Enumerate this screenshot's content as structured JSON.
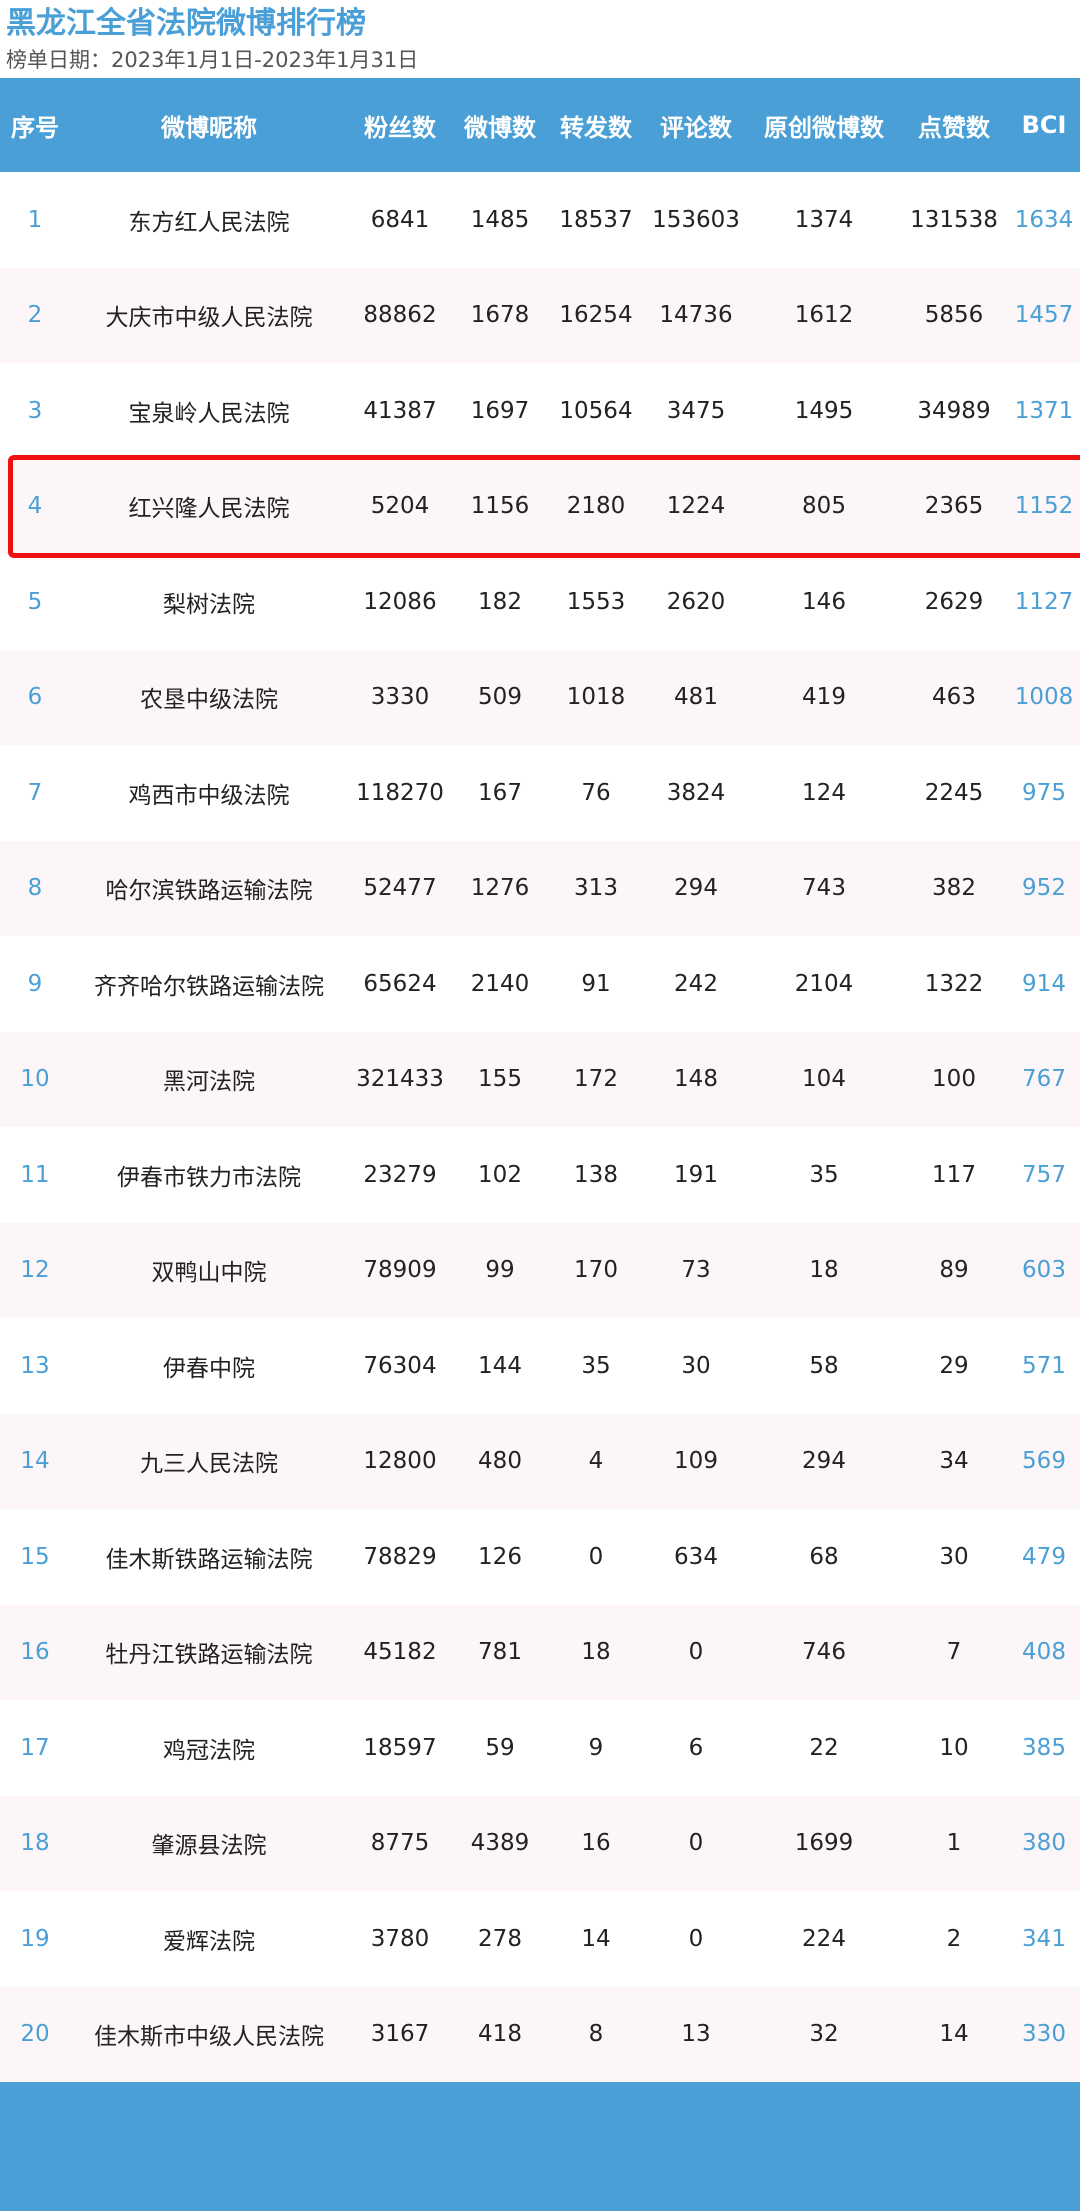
{
  "page": {
    "title": "黑龙江全省法院微博排行榜",
    "subtitle": "榜单日期：2023年1月1日-2023年1月31日"
  },
  "colors": {
    "accent": "#4a9fd6",
    "highlight": "#ee1111",
    "row_alt": "#fdf6f8"
  },
  "table": {
    "headers": [
      "序号",
      "微博昵称",
      "粉丝数",
      "微博数",
      "转发数",
      "评论数",
      "原创微博数",
      "点赞数",
      "BCI"
    ],
    "highlighted_rank": "4",
    "rows": [
      {
        "rank": "1",
        "name": "东方红人民法院",
        "fans": "6841",
        "posts": "1485",
        "reposts": "18537",
        "comments": "153603",
        "original": "1374",
        "likes": "131538",
        "bci": "1634"
      },
      {
        "rank": "2",
        "name": "大庆市中级人民法院",
        "fans": "88862",
        "posts": "1678",
        "reposts": "16254",
        "comments": "14736",
        "original": "1612",
        "likes": "5856",
        "bci": "1457"
      },
      {
        "rank": "3",
        "name": "宝泉岭人民法院",
        "fans": "41387",
        "posts": "1697",
        "reposts": "10564",
        "comments": "3475",
        "original": "1495",
        "likes": "34989",
        "bci": "1371"
      },
      {
        "rank": "4",
        "name": "红兴隆人民法院",
        "fans": "5204",
        "posts": "1156",
        "reposts": "2180",
        "comments": "1224",
        "original": "805",
        "likes": "2365",
        "bci": "1152"
      },
      {
        "rank": "5",
        "name": "梨树法院",
        "fans": "12086",
        "posts": "182",
        "reposts": "1553",
        "comments": "2620",
        "original": "146",
        "likes": "2629",
        "bci": "1127"
      },
      {
        "rank": "6",
        "name": "农垦中级法院",
        "fans": "3330",
        "posts": "509",
        "reposts": "1018",
        "comments": "481",
        "original": "419",
        "likes": "463",
        "bci": "1008"
      },
      {
        "rank": "7",
        "name": "鸡西市中级法院",
        "fans": "118270",
        "posts": "167",
        "reposts": "76",
        "comments": "3824",
        "original": "124",
        "likes": "2245",
        "bci": "975"
      },
      {
        "rank": "8",
        "name": "哈尔滨铁路运输法院",
        "fans": "52477",
        "posts": "1276",
        "reposts": "313",
        "comments": "294",
        "original": "743",
        "likes": "382",
        "bci": "952"
      },
      {
        "rank": "9",
        "name": "齐齐哈尔铁路运输法院",
        "fans": "65624",
        "posts": "2140",
        "reposts": "91",
        "comments": "242",
        "original": "2104",
        "likes": "1322",
        "bci": "914"
      },
      {
        "rank": "10",
        "name": "黑河法院",
        "fans": "321433",
        "posts": "155",
        "reposts": "172",
        "comments": "148",
        "original": "104",
        "likes": "100",
        "bci": "767"
      },
      {
        "rank": "11",
        "name": "伊春市铁力市法院",
        "fans": "23279",
        "posts": "102",
        "reposts": "138",
        "comments": "191",
        "original": "35",
        "likes": "117",
        "bci": "757"
      },
      {
        "rank": "12",
        "name": "双鸭山中院",
        "fans": "78909",
        "posts": "99",
        "reposts": "170",
        "comments": "73",
        "original": "18",
        "likes": "89",
        "bci": "603"
      },
      {
        "rank": "13",
        "name": "伊春中院",
        "fans": "76304",
        "posts": "144",
        "reposts": "35",
        "comments": "30",
        "original": "58",
        "likes": "29",
        "bci": "571"
      },
      {
        "rank": "14",
        "name": "九三人民法院",
        "fans": "12800",
        "posts": "480",
        "reposts": "4",
        "comments": "109",
        "original": "294",
        "likes": "34",
        "bci": "569"
      },
      {
        "rank": "15",
        "name": "佳木斯铁路运输法院",
        "fans": "78829",
        "posts": "126",
        "reposts": "0",
        "comments": "634",
        "original": "68",
        "likes": "30",
        "bci": "479"
      },
      {
        "rank": "16",
        "name": "牡丹江铁路运输法院",
        "fans": "45182",
        "posts": "781",
        "reposts": "18",
        "comments": "0",
        "original": "746",
        "likes": "7",
        "bci": "408"
      },
      {
        "rank": "17",
        "name": "鸡冠法院",
        "fans": "18597",
        "posts": "59",
        "reposts": "9",
        "comments": "6",
        "original": "22",
        "likes": "10",
        "bci": "385"
      },
      {
        "rank": "18",
        "name": "肇源县法院",
        "fans": "8775",
        "posts": "4389",
        "reposts": "16",
        "comments": "0",
        "original": "1699",
        "likes": "1",
        "bci": "380"
      },
      {
        "rank": "19",
        "name": "爱辉法院",
        "fans": "3780",
        "posts": "278",
        "reposts": "14",
        "comments": "0",
        "original": "224",
        "likes": "2",
        "bci": "341"
      },
      {
        "rank": "20",
        "name": "佳木斯市中级人民法院",
        "fans": "3167",
        "posts": "418",
        "reposts": "8",
        "comments": "13",
        "original": "32",
        "likes": "14",
        "bci": "330"
      }
    ]
  }
}
